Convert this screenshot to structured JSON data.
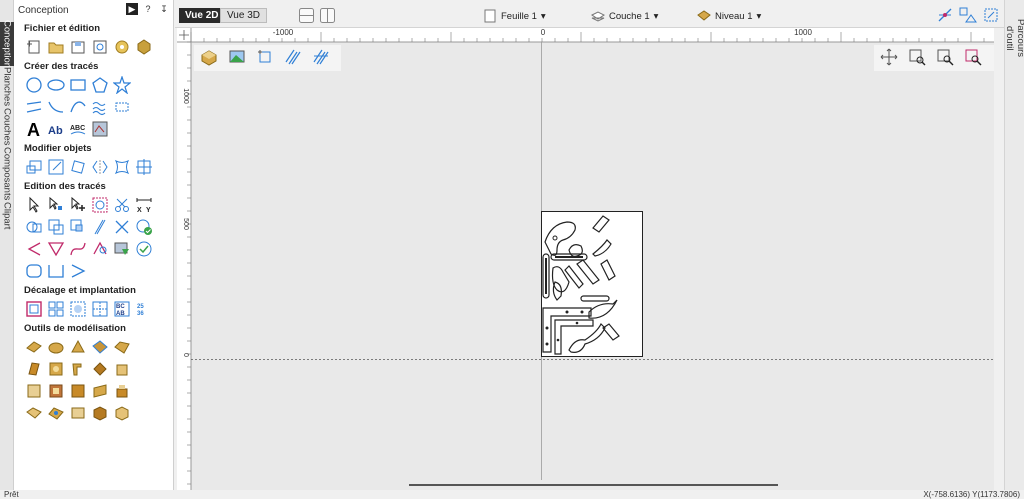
{
  "panel": {
    "title": "Conception",
    "controls": [
      "?",
      "↧"
    ],
    "sections": [
      {
        "title": "Fichier et édition",
        "icons": [
          "new-file-icon",
          "open-file-icon",
          "save-file-icon",
          "import-vector-icon",
          "job-setup-icon",
          "settings-icon"
        ]
      },
      {
        "title": "Créer des tracés",
        "icons": [
          "circle-icon",
          "ellipse-icon",
          "rectangle-icon",
          "polygon-icon",
          "star-icon",
          "polyline-icon",
          "arc-icon",
          "curve-icon",
          "wave-icon",
          "dimension-icon",
          "text-icon",
          "text-on-curve-icon",
          "text-arc-icon",
          "bitmap-trace-icon"
        ]
      },
      {
        "title": "Modifier objets",
        "icons": [
          "move-icon",
          "scale-icon",
          "rotate-icon",
          "mirror-icon",
          "distort-icon",
          "align-icon"
        ]
      },
      {
        "title": "Edition des tracés",
        "icons": [
          "select-icon",
          "node-edit-icon",
          "add-node-icon",
          "trim-icon",
          "scissors-icon",
          "measure-icon",
          "weld-icon",
          "subtract-icon",
          "intersect-icon",
          "join-icon",
          "cut-icon",
          "check-icon",
          "fillet-icon",
          "chamfer-icon",
          "spline-icon",
          "offset-curve-icon",
          "smooth-icon",
          "validate-icon",
          "rounded-rect-icon",
          "bracket-icon",
          "chevron-icon"
        ]
      },
      {
        "title": "Décalage et implantation",
        "icons": [
          "offset-icon",
          "array-icon",
          "nest-icon",
          "tile-icon",
          "layout-abcd-icon",
          "layout-123-icon"
        ]
      },
      {
        "title": "Outils de modélisation",
        "icons": [
          "model-1-icon",
          "model-2-icon",
          "model-3-icon",
          "model-4-icon",
          "model-5-icon",
          "model-6-icon",
          "model-7-icon",
          "model-8-icon",
          "model-9-icon",
          "model-10-icon",
          "model-11-icon",
          "model-12-icon",
          "model-13-icon",
          "model-14-icon",
          "model-15-icon",
          "model-16-icon",
          "model-17-icon",
          "model-18-icon",
          "model-19-icon",
          "model-20-icon"
        ]
      }
    ]
  },
  "left_tabs": [
    "Conception",
    "Planches",
    "Couches",
    "Composants",
    "Clipart"
  ],
  "right_tabs": [
    "Parcours d'outil"
  ],
  "toolbar": {
    "view_2d": "Vue 2D",
    "view_3d": "Vue 3D",
    "sheet": "Feuille 1",
    "layer": "Couche 1",
    "level": "Niveau 1",
    "dropdown_arrow": "▾"
  },
  "ruler": {
    "h_labels": [
      "-1000",
      "0",
      "1000"
    ],
    "v_labels": [
      "1000",
      "500",
      "0"
    ]
  },
  "status": {
    "left": "Prêt",
    "coords": "X(-758.6136) Y(1173.7806)"
  },
  "colors": {
    "accent_blue": "#2f7fd6",
    "model_gold": "#d6a84a",
    "active_tab": "#2b2b2b"
  }
}
